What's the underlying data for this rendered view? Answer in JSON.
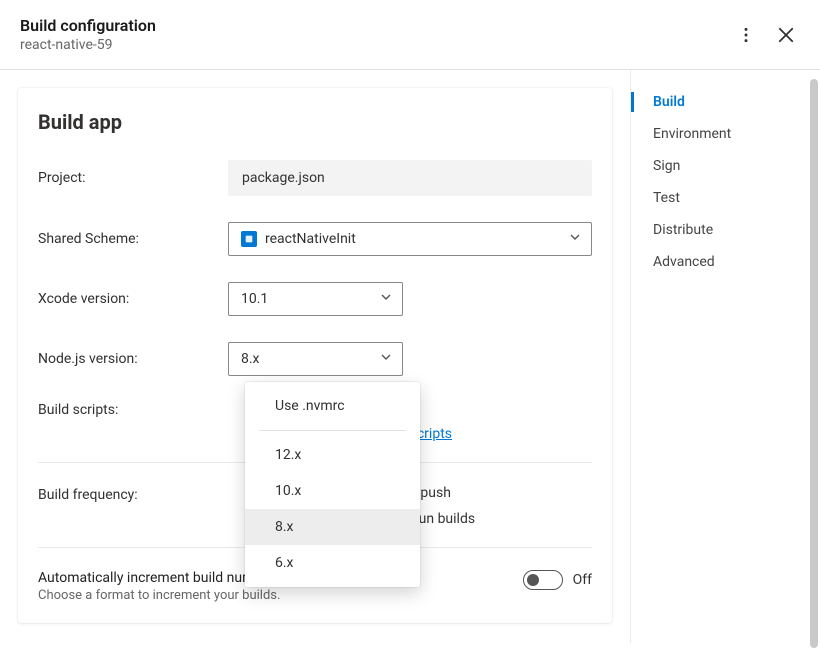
{
  "header": {
    "title": "Build configuration",
    "subtitle": "react-native-59"
  },
  "card": {
    "title": "Build app",
    "project_label": "Project:",
    "project_value": "package.json",
    "scheme_label": "Shared Scheme:",
    "scheme_value": "reactNativeInit",
    "xcode_label": "Xcode version:",
    "xcode_value": "10.1",
    "node_label": "Node.js version:",
    "node_value": "8.x",
    "scripts_label": "Build scripts:",
    "scripts_link_partial": "scripts",
    "freq_label": "Build frequency:",
    "freq_opt1_partial": "ery push",
    "freq_opt2_partial": "to run builds",
    "auto_title": "Automatically increment build number",
    "auto_sub": "Choose a format to increment your builds.",
    "toggle_state": "Off"
  },
  "node_dropdown": {
    "opt0": "Use .nvmrc",
    "opt1": "12.x",
    "opt2": "10.x",
    "opt3": "8.x",
    "opt4": "6.x",
    "selected": "8.x"
  },
  "sidebar": {
    "items": [
      {
        "label": "Build",
        "active": true
      },
      {
        "label": "Environment"
      },
      {
        "label": "Sign"
      },
      {
        "label": "Test"
      },
      {
        "label": "Distribute"
      },
      {
        "label": "Advanced"
      }
    ]
  }
}
